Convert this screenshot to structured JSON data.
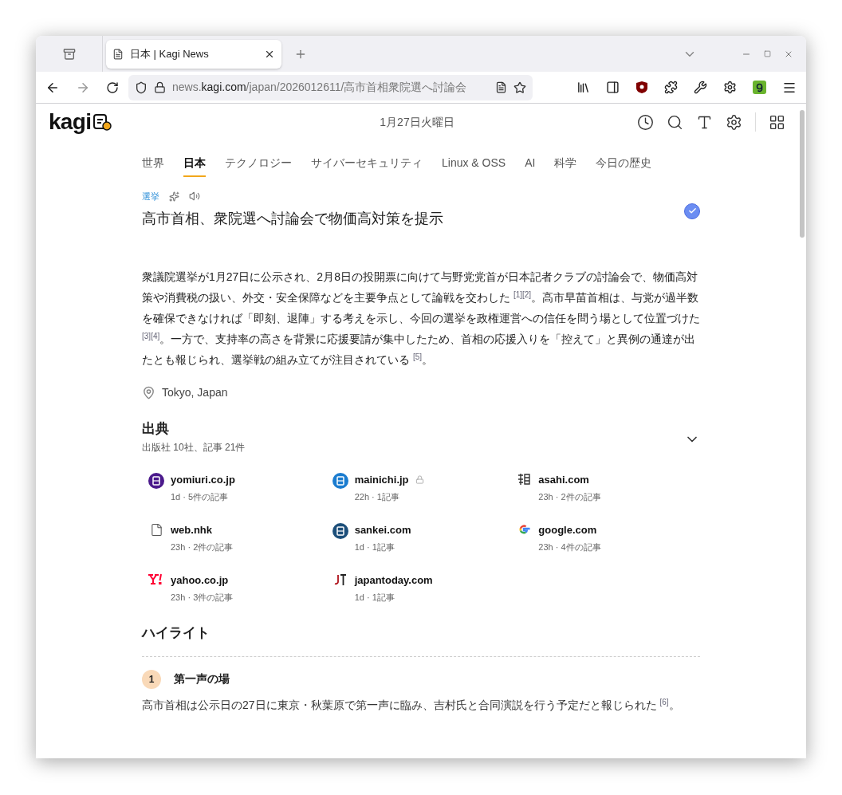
{
  "browser": {
    "tabs": [
      {
        "title": "日本 | Kagi News",
        "selected": true
      }
    ],
    "url": {
      "prefix": "news.",
      "host": "kagi.com",
      "path": "/japan/2026012611/高市首相衆院選へ討論会"
    }
  },
  "header": {
    "logo": "kagi",
    "date": "1月27日火曜日"
  },
  "categories": [
    {
      "label": "世界",
      "selected": false
    },
    {
      "label": "日本",
      "selected": true
    },
    {
      "label": "テクノロジー",
      "selected": false
    },
    {
      "label": "サイバーセキュリティ",
      "selected": false
    },
    {
      "label": "Linux & OSS",
      "selected": false
    },
    {
      "label": "AI",
      "selected": false
    },
    {
      "label": "科学",
      "selected": false
    },
    {
      "label": "今日の歴史",
      "selected": false
    }
  ],
  "article": {
    "tag": "選挙",
    "title": "高市首相、衆院選へ討論会で物価高対策を提示",
    "verified": true,
    "body": "衆議院選挙が1月27日に公示され、2月8日の投開票に向けて与野党党首が日本記者クラブの討論会で、物価高対策や消費税の扱い、外交・安全保障などを主要争点として論戦を交わした $^{[1]}$$^{[2]}$。高市早苗首相は、与党が過半数を確保できなければ「即刻、退陣」する考えを示し、今回の選挙を政権運営への信任を問う場として位置づけた $^{[3]}$$^{[4]}$。一方で、支持率の高さを背景に応援要請が集中したため、首相の応援入りを「控えて」と異例の通達が出たとも報じられ、選挙戦の組み立てが注目されている $^{[5]}$。",
    "location": "Tokyo, Japan"
  },
  "sources": {
    "title": "出典",
    "summary": "出版社 10社、記事 21件",
    "items": [
      {
        "name": "yomiuri.co.jp",
        "meta": "1d · 5件の記事",
        "kind": "seal",
        "color": "#4b1a8c",
        "locked": false
      },
      {
        "name": "mainichi.jp",
        "meta": "22h · 1記事",
        "kind": "seal",
        "color": "#1b7ccf",
        "locked": true
      },
      {
        "name": "asahi.com",
        "meta": "23h · 2件の記事",
        "kind": "mark",
        "locked": false
      },
      {
        "name": "web.nhk",
        "meta": "23h · 2件の記事",
        "kind": "document",
        "locked": false
      },
      {
        "name": "sankei.com",
        "meta": "1d · 1記事",
        "kind": "seal",
        "color": "#1d4f7a",
        "locked": false
      },
      {
        "name": "google.com",
        "meta": "23h · 4件の記事",
        "kind": "google",
        "color": "#4285f4",
        "locked": false
      },
      {
        "name": "yahoo.co.jp",
        "meta": "23h · 3件の記事",
        "kind": "yahoo",
        "color": "#ff0033",
        "locked": false
      },
      {
        "name": "japantoday.com",
        "meta": "1d · 1記事",
        "kind": "jt",
        "locked": false
      }
    ]
  },
  "highlights": {
    "title": "ハイライト",
    "items": [
      {
        "number": "1",
        "title": "第一声の場",
        "text": "高市首相は公示日の27日に東京・秋葉原で第一声に臨み、吉村氏と合同演説を行う予定だと報じられた $^{[6]}$。"
      }
    ]
  }
}
